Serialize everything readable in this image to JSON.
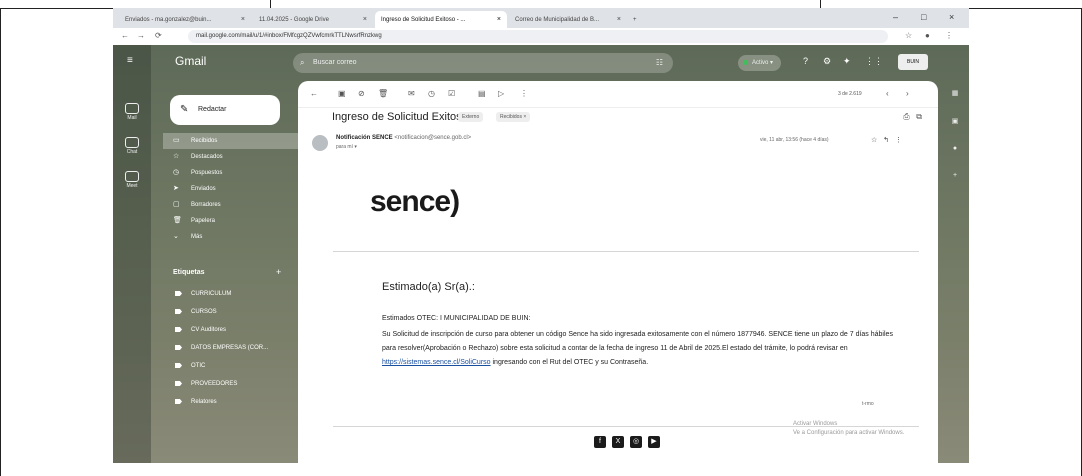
{
  "browser": {
    "tabs": [
      {
        "label": "Enviados - ma.gonzalez@buin..."
      },
      {
        "label": "11.04.2025 - Google Drive"
      },
      {
        "label": "Ingreso de Solicitud Exitoso - ..."
      },
      {
        "label": "Correo de Municipalidad de B..."
      }
    ],
    "new_tab": "+",
    "url": "mail.google.com/mail/u/1/#inbox/FMfcgzQZVwfcmrkTTLNwsrfRnzkwg",
    "window_controls": [
      "–",
      "□",
      "×"
    ]
  },
  "gmail": {
    "app_name": "Gmail",
    "search_placeholder": "Buscar correo",
    "status_label": "Activo",
    "account_label": "BUIN",
    "rail": [
      {
        "label": "Mail"
      },
      {
        "label": "Chat"
      },
      {
        "label": "Meet"
      }
    ],
    "compose_label": "Redactar",
    "nav": [
      {
        "label": "Recibidos",
        "icon": "inbox-icon"
      },
      {
        "label": "Destacados",
        "icon": "star-icon"
      },
      {
        "label": "Pospuestos",
        "icon": "clock-icon"
      },
      {
        "label": "Enviados",
        "icon": "send-icon"
      },
      {
        "label": "Borradores",
        "icon": "draft-icon"
      },
      {
        "label": "Papelera",
        "icon": "trash-icon"
      },
      {
        "label": "Más",
        "icon": "chevron-down-icon"
      }
    ],
    "labels_heading": "Etiquetas",
    "labels": [
      {
        "label": "CURRICULUM"
      },
      {
        "label": "CURSOS"
      },
      {
        "label": "CV Auditores"
      },
      {
        "label": "DATOS EMPRESAS (COR..."
      },
      {
        "label": "OTIC"
      },
      {
        "label": "PROVEEDORES"
      },
      {
        "label": "Relatores"
      }
    ],
    "pagination": "3 de 2.619"
  },
  "email": {
    "subject": "Ingreso de Solicitud Exitoso",
    "chip_external": "Externo",
    "chip_inbox": "Recibidos ×",
    "sender_name": "Notificación SENCE",
    "sender_email": "<notificacion@sence.gob.cl>",
    "to": "para mí ▾",
    "date": "vie, 11 abr, 13:56 (hace 4 días)",
    "brand": "sence)",
    "greeting": "Estimado(a) Sr(a).:",
    "line1": "Estimados OTEC: I MUNICIPALIDAD DE BUIN:",
    "line2": "Su Solicitud de inscripción de curso para obtener un código Sence ha sido ingresada exitosamente con el número 1877946. SENCE tiene un plazo de 7 días hábiles para resolver(Aprobación o Rechazo) sobre esta solicitud a contar de la fecha de ingreso 11 de Abril de 2025.El estado del trámite, lo podrá revisar en",
    "link": "https://sistemas.sence.cl/SoliCurso",
    "line3": "ingresando con el Rut del OTEC y su Contraseña.",
    "footer_small": "t-rmo"
  },
  "windows_notice": {
    "line1": "Activar Windows",
    "line2": "Ve a Configuración para activar Windows."
  },
  "colors": {
    "link": "#1a4fa0",
    "status_dot": "#3fbf5a"
  }
}
